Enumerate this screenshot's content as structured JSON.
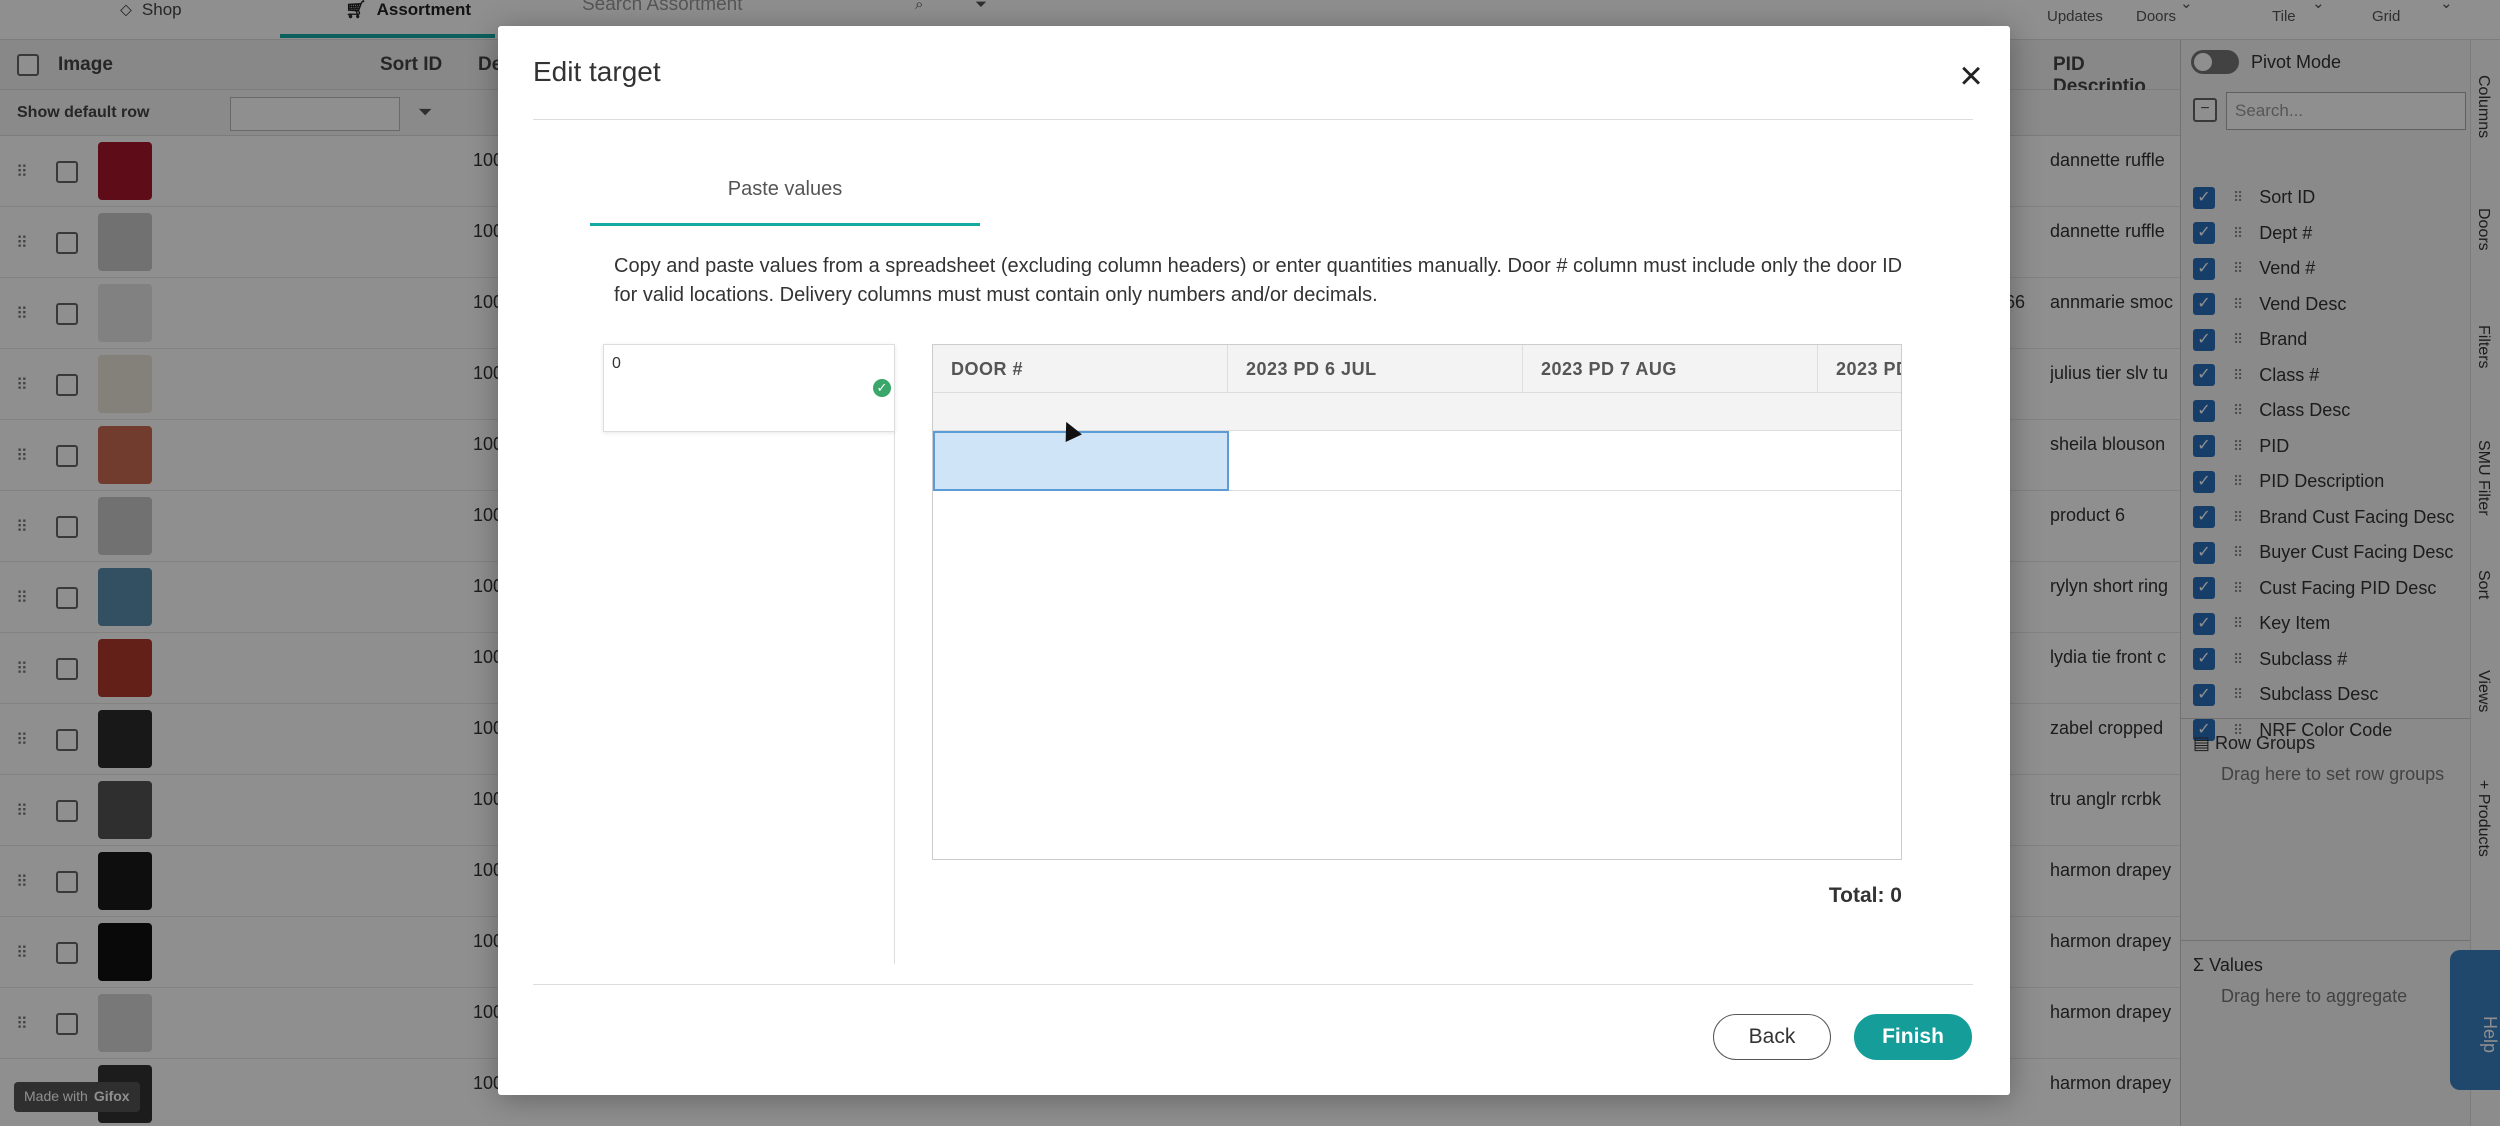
{
  "app": {
    "nav": {
      "shop_label": "Shop",
      "assortment_label": "Assortment",
      "search_placeholder": "Search Assortment"
    },
    "toolbar": {
      "updates_label": "Updates",
      "doors_label": "Doors",
      "tile_label": "Tile",
      "grid_label": "Grid"
    },
    "grid": {
      "headers": {
        "image": "Image",
        "sort_id": "Sort ID",
        "dept": "De",
        "pid_description": "PID Descriptio"
      },
      "show_default_row": "Show default row",
      "rows": [
        {
          "num": "100",
          "pid": "dannette ruffle",
          "thumb": "#a8162b"
        },
        {
          "num": "100",
          "pid": "dannette ruffle",
          "thumb": "#c9c9c9"
        },
        {
          "num": "100",
          "pid": "annmarie smoc",
          "thumb": "#e6e6e6",
          "extra": "66"
        },
        {
          "num": "100",
          "pid": "julius tier slv tu",
          "thumb": "#ece6dc"
        },
        {
          "num": "100",
          "pid": "sheila blouson",
          "thumb": "#c96a52"
        },
        {
          "num": "100",
          "pid": "product 6",
          "thumb": "#c9c9c9"
        },
        {
          "num": "100",
          "pid": "rylyn short ring",
          "thumb": "#5b8fb0"
        },
        {
          "num": "100",
          "pid": "lydia tie front c",
          "thumb": "#b03a2e"
        },
        {
          "num": "100",
          "pid": "zabel cropped",
          "thumb": "#2c2c2c"
        },
        {
          "num": "100",
          "pid": "tru anglr rcrbk",
          "thumb": "#555555"
        },
        {
          "num": "100",
          "pid": "harmon drapey",
          "thumb": "#1a1a1a"
        },
        {
          "num": "100",
          "pid": "harmon drapey",
          "thumb": "#111111"
        },
        {
          "num": "100",
          "pid": "harmon drapey",
          "thumb": "#d6d6d6"
        },
        {
          "num": "100",
          "pid": "harmon drapey",
          "thumb": "#333333"
        }
      ]
    },
    "side_panel": {
      "pivot_mode": "Pivot Mode",
      "search_placeholder": "Search...",
      "columns": [
        "Sort ID",
        "Dept #",
        "Vend #",
        "Vend Desc",
        "Brand",
        "Class #",
        "Class Desc",
        "PID",
        "PID Description",
        "Brand Cust Facing Desc",
        "Buyer Cust Facing Desc",
        "Cust Facing PID Desc",
        "Key Item",
        "Subclass #",
        "Subclass Desc",
        "NRF Color Code"
      ],
      "row_groups": "Row Groups",
      "row_groups_hint": "Drag here to set row groups",
      "values": "Values",
      "values_hint": "Drag here to aggregate"
    },
    "side_tabs": [
      "Columns",
      "Doors",
      "Filters",
      "SMU Filter",
      "Sort",
      "Views",
      "+ Products"
    ],
    "help_label": "Help",
    "gifox_made_with": "Made with",
    "gifox_brand": "Gifox"
  },
  "modal": {
    "title": "Edit target",
    "tab": "Paste values",
    "instructions": "Copy and paste values from a spreadsheet (excluding column headers) or enter quantities manually. Door # column must include only the door ID for valid locations. Delivery columns must must contain only numbers and/or decimals.",
    "left_item_label": "0",
    "table": {
      "columns": [
        "DOOR #",
        "2023 PD 6 JUL",
        "2023 PD 7 AUG",
        "2023 PD"
      ]
    },
    "total": "Total: 0",
    "back_label": "Back",
    "finish_label": "Finish"
  }
}
